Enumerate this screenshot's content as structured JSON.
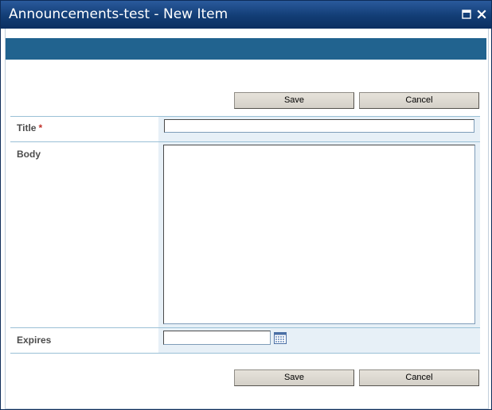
{
  "window": {
    "title": "Announcements-test - New Item",
    "maximize_icon": "maximize-icon",
    "close_icon": "close-icon"
  },
  "toolbar_top": {
    "save_label": "Save",
    "cancel_label": "Cancel"
  },
  "form": {
    "title": {
      "label": "Title",
      "required_marker": "*",
      "value": ""
    },
    "body": {
      "label": "Body",
      "value": ""
    },
    "expires": {
      "label": "Expires",
      "value": "",
      "date_picker_icon": "calendar-icon"
    }
  },
  "toolbar_bottom": {
    "save_label": "Save",
    "cancel_label": "Cancel"
  },
  "colors": {
    "titlebar": "#123d75",
    "ribbon": "#21638f",
    "field_background": "#e7f0f7",
    "row_divider": "#9ac0d6",
    "required": "#c1312a"
  }
}
